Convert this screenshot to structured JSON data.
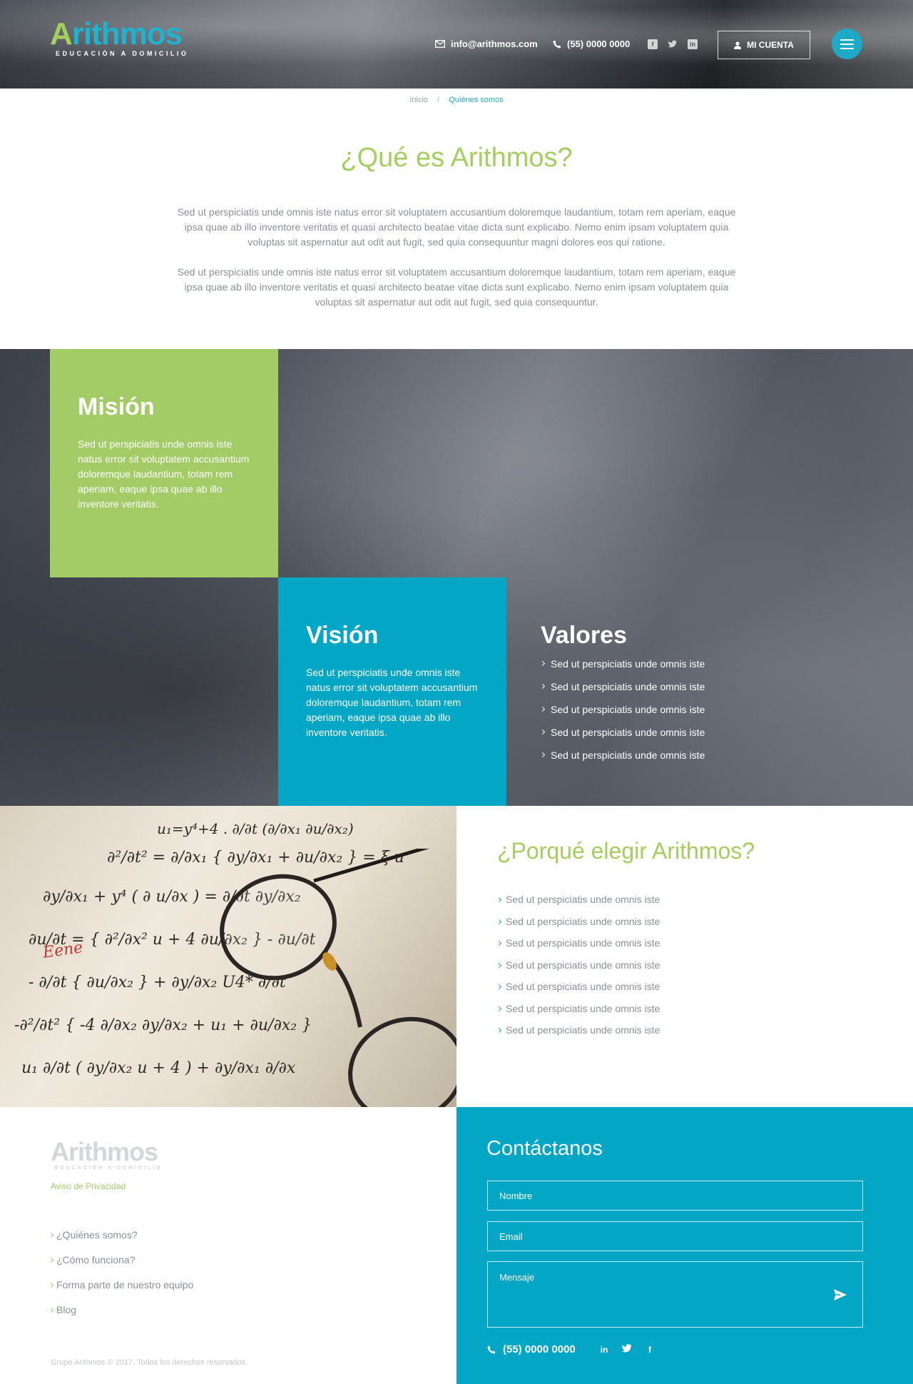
{
  "brand": {
    "logo_first_letter": "A",
    "logo_rest": "rithmos",
    "tagline": "EDUCACIÓN A DOMICILIO",
    "primary_color": "#1ea9c6",
    "accent_green": "#a3cf5e"
  },
  "header": {
    "email": "info@arithmos.com",
    "phone": "(55) 0000 0000",
    "social_icons": [
      "facebook-icon",
      "twitter-icon",
      "linkedin-icon"
    ],
    "account_label": "MI CUENTA"
  },
  "breadcrumb": {
    "home": "Inicio",
    "separator": "/",
    "current": "Quiénes somos"
  },
  "intro": {
    "title": "¿Qué es Arithmos?",
    "paragraph1": "Sed ut perspiciatis unde omnis iste natus error sit voluptatem accusantium doloremque laudantium, totam rem aperiam, eaque ipsa quae ab illo inventore veritatis et quasi architecto beatae vitae dicta sunt explicabo. Nemo enim ipsam voluptatem quia voluptas sit aspernatur aut odit aut fugit, sed quia consequuntur magni dolores eos qui ratione.",
    "paragraph2": "Sed ut perspiciatis unde omnis iste natus error sit voluptatem accusantium doloremque laudantium, totam rem aperiam, eaque ipsa quae ab illo inventore veritatis et quasi architecto beatae vitae dicta sunt explicabo. Nemo enim ipsam voluptatem quia voluptas sit aspernatur aut odit aut fugit, sed quia consequuntur."
  },
  "mision": {
    "title": "Misión",
    "text": "Sed ut perspiciatis unde omnis iste natus error sit voluptatem accusantium doloremque laudantium, totam rem aperiam, eaque ipsa quae ab illo inventore veritatis."
  },
  "vision": {
    "title": "Visión",
    "text": "Sed ut perspiciatis unde omnis iste natus error sit voluptatem accusantium doloremque laudantium, totam rem aperiam, eaque ipsa quae ab illo inventore veritatis."
  },
  "valores": {
    "title": "Valores",
    "items": [
      "Sed ut perspiciatis unde omnis iste",
      "Sed ut perspiciatis unde omnis iste",
      "Sed ut perspiciatis unde omnis iste",
      "Sed ut perspiciatis unde omnis iste",
      "Sed ut perspiciatis unde omnis iste"
    ]
  },
  "why": {
    "title": "¿Porqué elegir Arithmos?",
    "items": [
      "Sed ut perspiciatis unde omnis iste",
      "Sed ut perspiciatis unde omnis iste",
      "Sed ut perspiciatis unde omnis iste",
      "Sed ut perspiciatis unde omnis iste",
      "Sed ut perspiciatis unde omnis iste",
      "Sed ut perspiciatis unde omnis iste",
      "Sed ut perspiciatis unde omnis iste"
    ]
  },
  "footer": {
    "privacy": "Aviso de Privacidad",
    "links": [
      "¿Quiénes somos?",
      "¿Cómo funciona?",
      "Forma parte de nuestro equipo",
      "Blog"
    ],
    "copyright": "Grupo Arithmos © 2017. Todos los derechos reservados."
  },
  "contact": {
    "title": "Contáctanos",
    "name_placeholder": "Nombre",
    "email_placeholder": "Email",
    "message_placeholder": "Mensaje",
    "phone": "(55) 0000 0000",
    "social": [
      "in",
      "t",
      "f"
    ],
    "social_icons": [
      "linkedin-icon",
      "twitter-icon",
      "facebook-icon"
    ]
  }
}
